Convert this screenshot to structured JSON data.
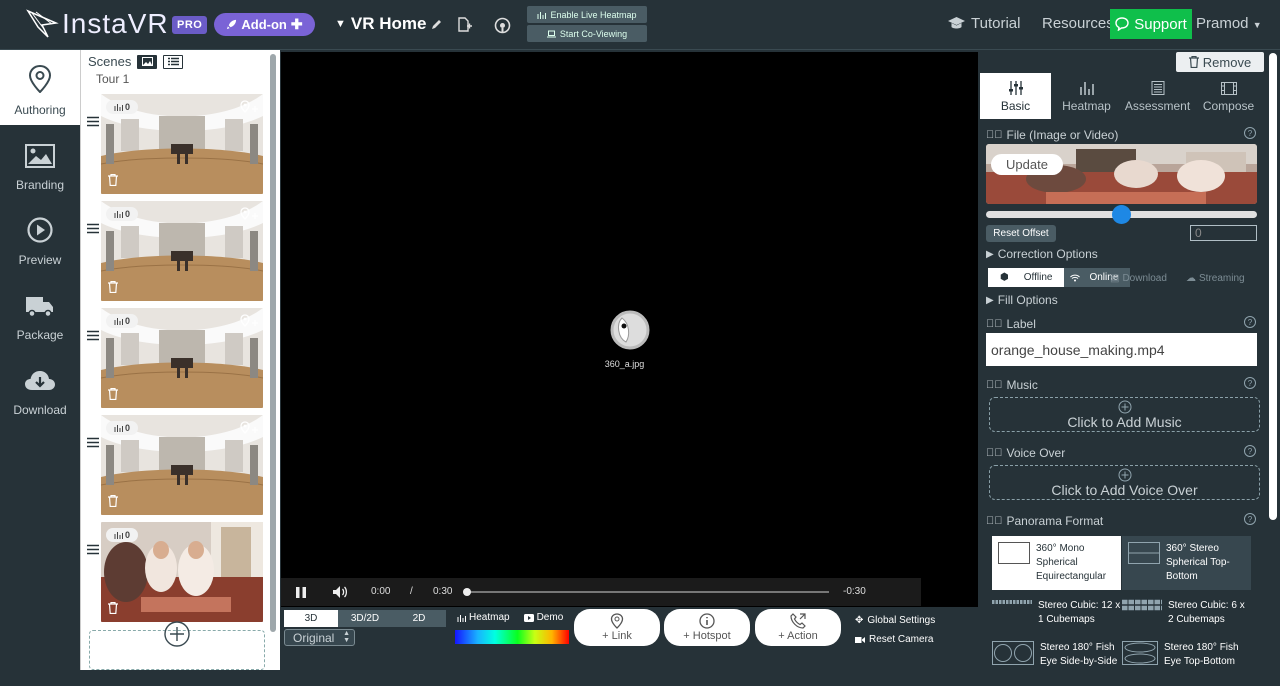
{
  "app": {
    "logo_text": "InstaVR",
    "pro_badge": "PRO",
    "addon_label": "Add-on",
    "project_title": "VR Home"
  },
  "topbar": {
    "heatmap_btn": "Enable Live Heatmap",
    "coview_btn": "Start Co-Viewing",
    "tutorial": "Tutorial",
    "resources": "Resources",
    "support": "Support",
    "user": "Pramod"
  },
  "leftnav": {
    "items": [
      {
        "label": "Authoring",
        "icon": "map-pin-icon"
      },
      {
        "label": "Branding",
        "icon": "image-icon"
      },
      {
        "label": "Preview",
        "icon": "play-circle-icon"
      },
      {
        "label": "Package",
        "icon": "truck-icon"
      },
      {
        "label": "Download",
        "icon": "cloud-download-icon"
      }
    ]
  },
  "scenes": {
    "header": "Scenes",
    "tour": "Tour 1",
    "items": [
      {
        "count": "0",
        "type": "room"
      },
      {
        "count": "0",
        "type": "room"
      },
      {
        "count": "0",
        "type": "room"
      },
      {
        "count": "0",
        "type": "room"
      },
      {
        "count": "0",
        "type": "people"
      }
    ]
  },
  "viewer": {
    "center_label": "360_a.jpg",
    "time_current": "0:00",
    "time_sep": "/",
    "time_total": "0:30",
    "time_remaining": "-0:30"
  },
  "bottombar": {
    "modes": [
      "3D",
      "3D/2D",
      "2D"
    ],
    "quality": "Original",
    "heatmap_label": "Heatmap",
    "demo_label": "Demo",
    "link_label": "+ Link",
    "hotspot_label": "+ Hotspot",
    "action_label": "+ Action",
    "global_settings": "Global Settings",
    "reset_camera": "Reset Camera"
  },
  "panel": {
    "remove": "Remove",
    "tabs": [
      "Basic",
      "Heatmap",
      "Assessment",
      "Compose"
    ],
    "file_section": "File (Image or Video)",
    "update": "Update",
    "offset_value": 0.5,
    "reset_offset": "Reset Offset",
    "offset_input": "0",
    "correction": "Correction Options",
    "offline": "Offline",
    "online": "Online",
    "download": "Download",
    "streaming": "Streaming",
    "fill_options": "Fill Options",
    "label_section": "Label",
    "label_value": "orange_house_making.mp4",
    "music_section": "Music",
    "music_add": "Click to Add Music",
    "voice_section": "Voice Over",
    "voice_add": "Click to Add Voice Over",
    "pano_section": "Panorama Format",
    "formats": [
      "360° Mono Spherical Equirectangular",
      "360° Stereo Spherical Top-Bottom",
      "Stereo Cubic: 12 x 1 Cubemaps",
      "Stereo Cubic: 6 x 2 Cubemaps",
      "Stereo 180° Fish Eye Side-by-Side",
      "Stereo 180° Fish Eye Top-Bottom"
    ]
  },
  "colors": {
    "accent": "#7a63d6",
    "support": "#0fbf4b",
    "bg": "#263238",
    "slider": "#1e88e5"
  }
}
